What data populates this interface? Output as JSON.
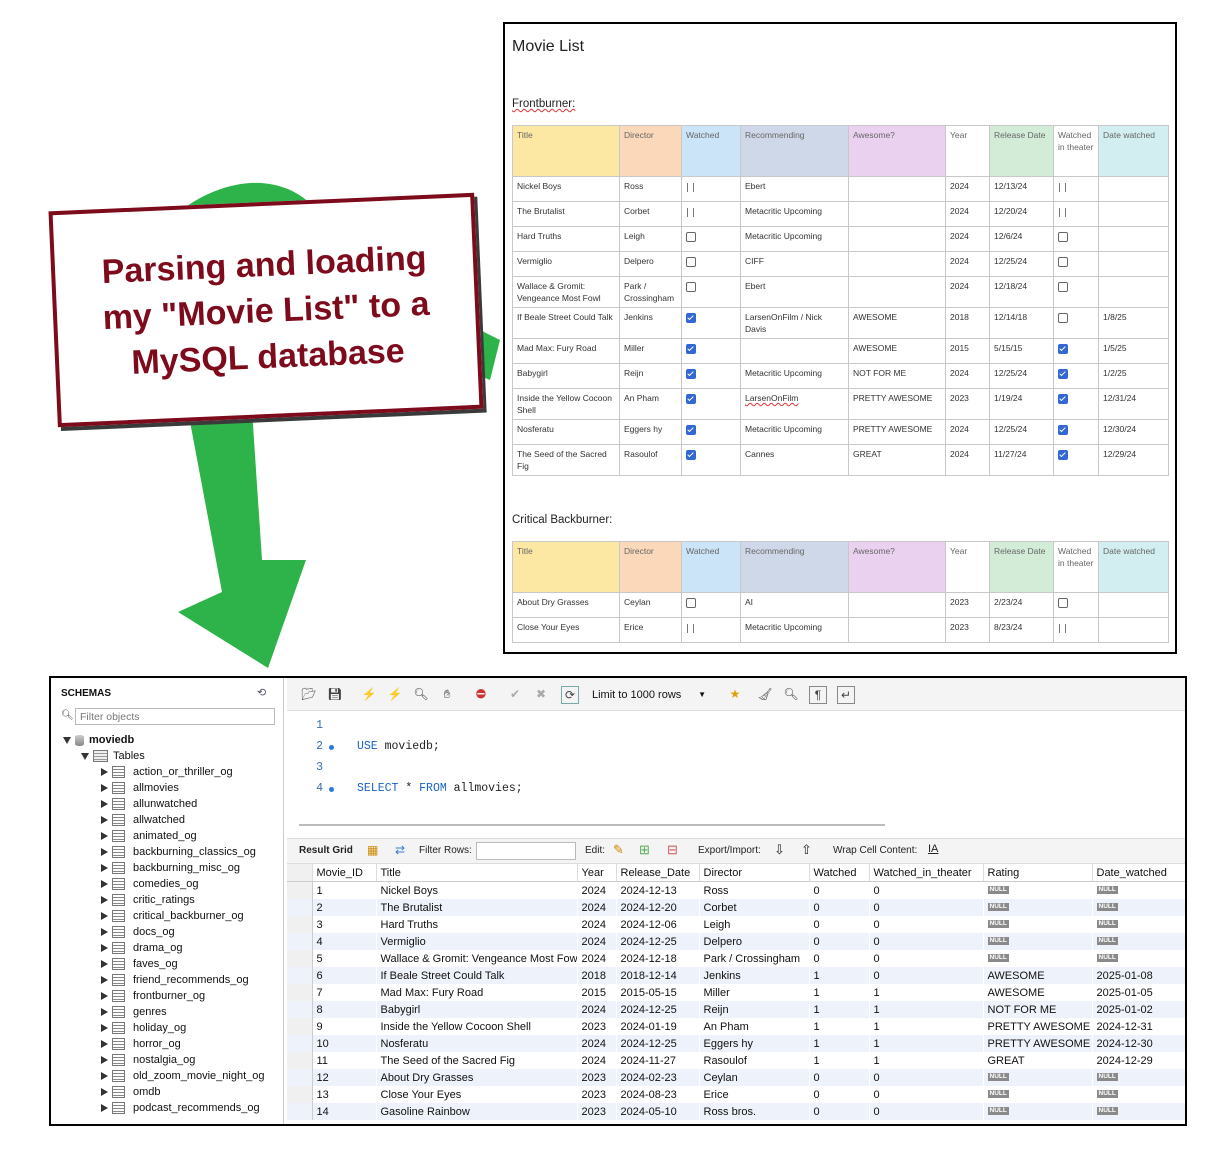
{
  "callout": {
    "line1": "Parsing and loading",
    "line2": "my \"Movie List\" to a",
    "line3": "MySQL database"
  },
  "doc": {
    "title": "Movie List",
    "section1": "Frontburner:",
    "section2": "Critical Backburner:",
    "headers": [
      "Title",
      "Director",
      "Watched",
      "Recommending",
      "Awesome?",
      "Year",
      "Release Date",
      "Watched in theater",
      "Date watched"
    ],
    "frontburner": [
      {
        "title": "Nickel Boys",
        "director": "Ross",
        "watched": "partial",
        "rec": "Ebert",
        "awesome": "",
        "year": "2024",
        "release": "12/13/24",
        "theater": "partial",
        "date": ""
      },
      {
        "title": "The Brutalist",
        "director": "Corbet",
        "watched": "partial",
        "rec": "Metacritic Upcoming",
        "awesome": "",
        "year": "2024",
        "release": "12/20/24",
        "theater": "partial",
        "date": ""
      },
      {
        "title": "Hard Truths",
        "director": "Leigh",
        "watched": "off",
        "rec": "Metacritic Upcoming",
        "awesome": "",
        "year": "2024",
        "release": "12/6/24",
        "theater": "off",
        "date": ""
      },
      {
        "title": "Vermiglio",
        "director": "Delpero",
        "watched": "off",
        "rec": "CIFF",
        "awesome": "",
        "year": "2024",
        "release": "12/25/24",
        "theater": "off",
        "date": ""
      },
      {
        "title": "Wallace & Gromit: Vengeance Most Fowl",
        "director": "Park / Crossingham",
        "watched": "off",
        "rec": "Ebert",
        "awesome": "",
        "year": "2024",
        "release": "12/18/24",
        "theater": "off",
        "date": ""
      },
      {
        "title": "If Beale Street Could Talk",
        "director": "Jenkins",
        "watched": "on",
        "rec": "LarsenOnFilm / Nick Davis",
        "awesome": "AWESOME",
        "year": "2018",
        "release": "12/14/18",
        "theater": "off",
        "date": "1/8/25"
      },
      {
        "title": "Mad Max: Fury Road",
        "director": "Miller",
        "watched": "on",
        "rec": "",
        "awesome": "AWESOME",
        "year": "2015",
        "release": "5/15/15",
        "theater": "on",
        "date": "1/5/25"
      },
      {
        "title": "Babygirl",
        "director": "Reijn",
        "watched": "on",
        "rec": "Metacritic Upcoming",
        "awesome": "NOT FOR ME",
        "year": "2024",
        "release": "12/25/24",
        "theater": "on",
        "date": "1/2/25"
      },
      {
        "title": "Inside the Yellow Cocoon Shell",
        "director": "An Pham",
        "watched": "on",
        "rec": "LarsenOnFilm",
        "awesome": "PRETTY AWESOME",
        "year": "2023",
        "release": "1/19/24",
        "theater": "on",
        "date": "12/31/24"
      },
      {
        "title": "Nosferatu",
        "director": "Eggers  hy",
        "watched": "on",
        "rec": "Metacritic Upcoming",
        "awesome": "PRETTY AWESOME",
        "year": "2024",
        "release": "12/25/24",
        "theater": "on",
        "date": "12/30/24"
      },
      {
        "title": "The Seed of the Sacred Fig",
        "director": "Rasoulof",
        "watched": "on",
        "rec": "Cannes",
        "awesome": "GREAT",
        "year": "2024",
        "release": "11/27/24",
        "theater": "on",
        "date": "12/29/24"
      }
    ],
    "backburner": [
      {
        "title": "About Dry Grasses",
        "director": "Ceylan",
        "watched": "off",
        "rec": "AI",
        "awesome": "",
        "year": "2023",
        "release": "2/23/24",
        "theater": "off",
        "date": ""
      },
      {
        "title": "Close Your Eyes",
        "director": "Erice",
        "watched": "partial",
        "rec": "Metacritic Upcoming",
        "awesome": "",
        "year": "2023",
        "release": "8/23/24",
        "theater": "partial",
        "date": ""
      }
    ]
  },
  "workbench": {
    "schemas_label": "SCHEMAS",
    "filter_placeholder": "Filter objects",
    "schema_name": "moviedb",
    "tables_label": "Tables",
    "tables": [
      "action_or_thriller_og",
      "allmovies",
      "allunwatched",
      "allwatched",
      "animated_og",
      "backburning_classics_og",
      "backburning_misc_og",
      "comedies_og",
      "critic_ratings",
      "critical_backburner_og",
      "docs_og",
      "drama_og",
      "faves_og",
      "friend_recommends_og",
      "frontburner_og",
      "genres",
      "holiday_og",
      "horror_og",
      "nostalgia_og",
      "old_zoom_movie_night_og",
      "omdb",
      "podcast_recommends_og"
    ],
    "limit_label": "Limit to 1000 rows",
    "code": [
      {
        "n": "1",
        "kw1": "",
        "rest": "",
        "kw2": "",
        "tail": "",
        "dot": false
      },
      {
        "n": "2",
        "kw1": "USE",
        "rest": " moviedb;",
        "kw2": "",
        "tail": "",
        "dot": true
      },
      {
        "n": "3",
        "kw1": "",
        "rest": "",
        "kw2": "",
        "tail": "",
        "dot": false
      },
      {
        "n": "4",
        "kw1": "SELECT",
        "rest": " * ",
        "kw2": "FROM",
        "tail": " allmovies;",
        "dot": true
      }
    ],
    "grid_toolbar": {
      "result_grid": "Result Grid",
      "filter_rows": "Filter Rows:",
      "edit": "Edit:",
      "export_import": "Export/Import:",
      "wrap": "Wrap Cell Content:"
    },
    "columns": [
      "Movie_ID",
      "Title",
      "Year",
      "Release_Date",
      "Director",
      "Watched",
      "Watched_in_theater",
      "Rating",
      "Date_watched"
    ],
    "null_label": "NULL",
    "rows": [
      [
        "1",
        "Nickel Boys",
        "2024",
        "2024-12-13",
        "Ross",
        "0",
        "0",
        null,
        null
      ],
      [
        "2",
        "The Brutalist",
        "2024",
        "2024-12-20",
        "Corbet",
        "0",
        "0",
        null,
        null
      ],
      [
        "3",
        "Hard Truths",
        "2024",
        "2024-12-06",
        "Leigh",
        "0",
        "0",
        null,
        null
      ],
      [
        "4",
        "Vermiglio",
        "2024",
        "2024-12-25",
        "Delpero",
        "0",
        "0",
        null,
        null
      ],
      [
        "5",
        "Wallace & Gromit: Vengeance Most Fowl",
        "2024",
        "2024-12-18",
        "Park / Crossingham",
        "0",
        "0",
        null,
        null
      ],
      [
        "6",
        "If Beale Street Could Talk",
        "2018",
        "2018-12-14",
        "Jenkins",
        "1",
        "0",
        "AWESOME",
        "2025-01-08"
      ],
      [
        "7",
        "Mad Max: Fury Road",
        "2015",
        "2015-05-15",
        "Miller",
        "1",
        "1",
        "AWESOME",
        "2025-01-05"
      ],
      [
        "8",
        "Babygirl",
        "2024",
        "2024-12-25",
        "Reijn",
        "1",
        "1",
        "NOT FOR ME",
        "2025-01-02"
      ],
      [
        "9",
        "Inside the Yellow Cocoon Shell",
        "2023",
        "2024-01-19",
        "An Pham",
        "1",
        "1",
        "PRETTY AWESOME",
        "2024-12-31"
      ],
      [
        "10",
        "Nosferatu",
        "2024",
        "2024-12-25",
        "Eggers  hy",
        "1",
        "1",
        "PRETTY AWESOME",
        "2024-12-30"
      ],
      [
        "11",
        "The Seed of the Sacred Fig",
        "2024",
        "2024-11-27",
        "Rasoulof",
        "1",
        "1",
        "GREAT",
        "2024-12-29"
      ],
      [
        "12",
        "About Dry Grasses",
        "2023",
        "2024-02-23",
        "Ceylan",
        "0",
        "0",
        null,
        null
      ],
      [
        "13",
        "Close Your Eyes",
        "2023",
        "2024-08-23",
        "Erice",
        "0",
        "0",
        null,
        null
      ],
      [
        "14",
        "Gasoline Rainbow",
        "2023",
        "2024-05-10",
        "Ross bros.",
        "0",
        "0",
        null,
        null
      ]
    ]
  },
  "colors": {
    "callout_border": "#7d0b1c",
    "arrow": "#2db34a",
    "keyword": "#1a63c9"
  }
}
